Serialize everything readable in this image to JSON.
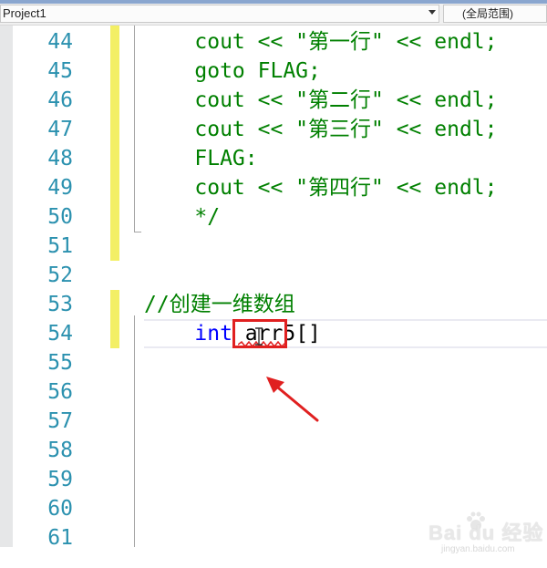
{
  "toolbar": {
    "project_dropdown": "Project1",
    "scope_dropdown": "(全局范围)"
  },
  "editor": {
    "line_numbers": [
      "44",
      "45",
      "46",
      "47",
      "48",
      "49",
      "50",
      "51",
      "52",
      "53",
      "54",
      "55",
      "56",
      "57",
      "58",
      "59",
      "60",
      "61"
    ],
    "code": {
      "l44": {
        "kw": "",
        "text": "    cout << \"第一行\" << endl;"
      },
      "l45": {
        "text": "    goto FLAG;"
      },
      "l46": {
        "text": "    cout << \"第二行\" << endl;"
      },
      "l47": {
        "text": "    cout << \"第三行\" << endl;"
      },
      "l48": {
        "text": "    FLAG:"
      },
      "l49": {
        "text": "    cout << \"第四行\" << endl;"
      },
      "l50": {
        "text": "    */"
      },
      "l53": {
        "text": "//创建一维数组"
      },
      "l54": {
        "indent": "    ",
        "keyword": "int",
        "identifier": " arr5",
        "brackets": "[]"
      }
    },
    "colors": {
      "keyword": "#0000ff",
      "comment": "#008000",
      "line_number": "#2b91af",
      "change_marker": "#f3ef65",
      "highlight_box": "#e02020"
    }
  },
  "watermark": {
    "main": "Bai du 经验",
    "sub": "jingyan.baidu.com"
  }
}
